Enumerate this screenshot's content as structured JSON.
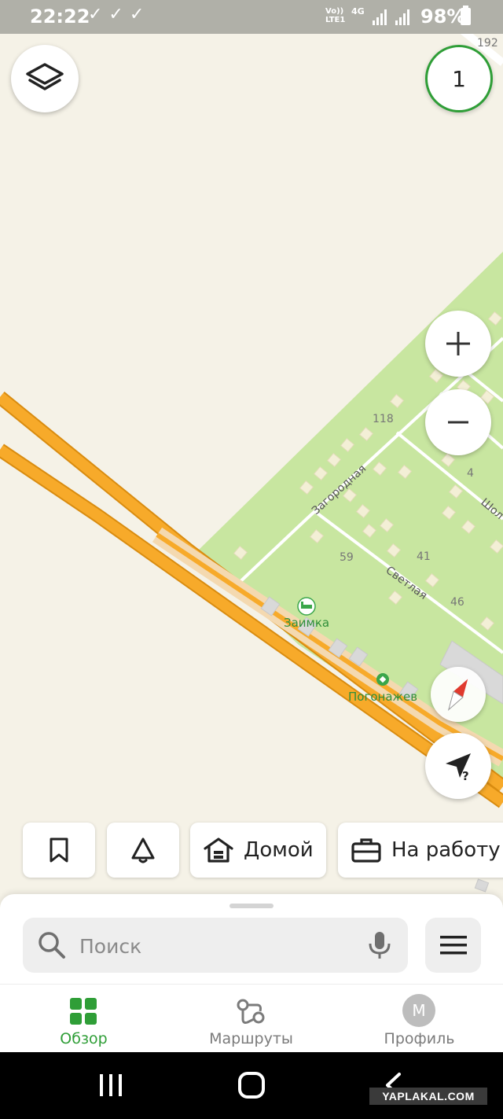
{
  "status_bar": {
    "time": "22:22",
    "checks": "✓✓✓",
    "volte": "Vo))\nLTE1",
    "network": "4G",
    "battery": "98%"
  },
  "map": {
    "badge_count": "1",
    "house_numbers": [
      "192",
      "118",
      "4",
      "59",
      "41",
      "46"
    ],
    "streets": [
      "Загородная",
      "Светлая",
      "Шол"
    ],
    "pois": [
      "Заимка",
      "Погонажев"
    ]
  },
  "quick_actions": {
    "home_label": "Домой",
    "work_label": "На работу"
  },
  "search": {
    "placeholder": "Поиск"
  },
  "tabs": [
    {
      "label": "Обзор",
      "icon": "grid-icon",
      "active": true
    },
    {
      "label": "Маршруты",
      "icon": "routes-icon",
      "active": false
    },
    {
      "label": "Профиль",
      "icon": "avatar",
      "active": false
    }
  ],
  "profile_initial": "М",
  "watermark": "YAPLAKAL.COM",
  "colors": {
    "map_background": "#f5f2e7",
    "green_area": "#c8e6a0",
    "road": "#f5a623",
    "accent": "#2f9e37",
    "compass_red": "#e03a2e"
  }
}
